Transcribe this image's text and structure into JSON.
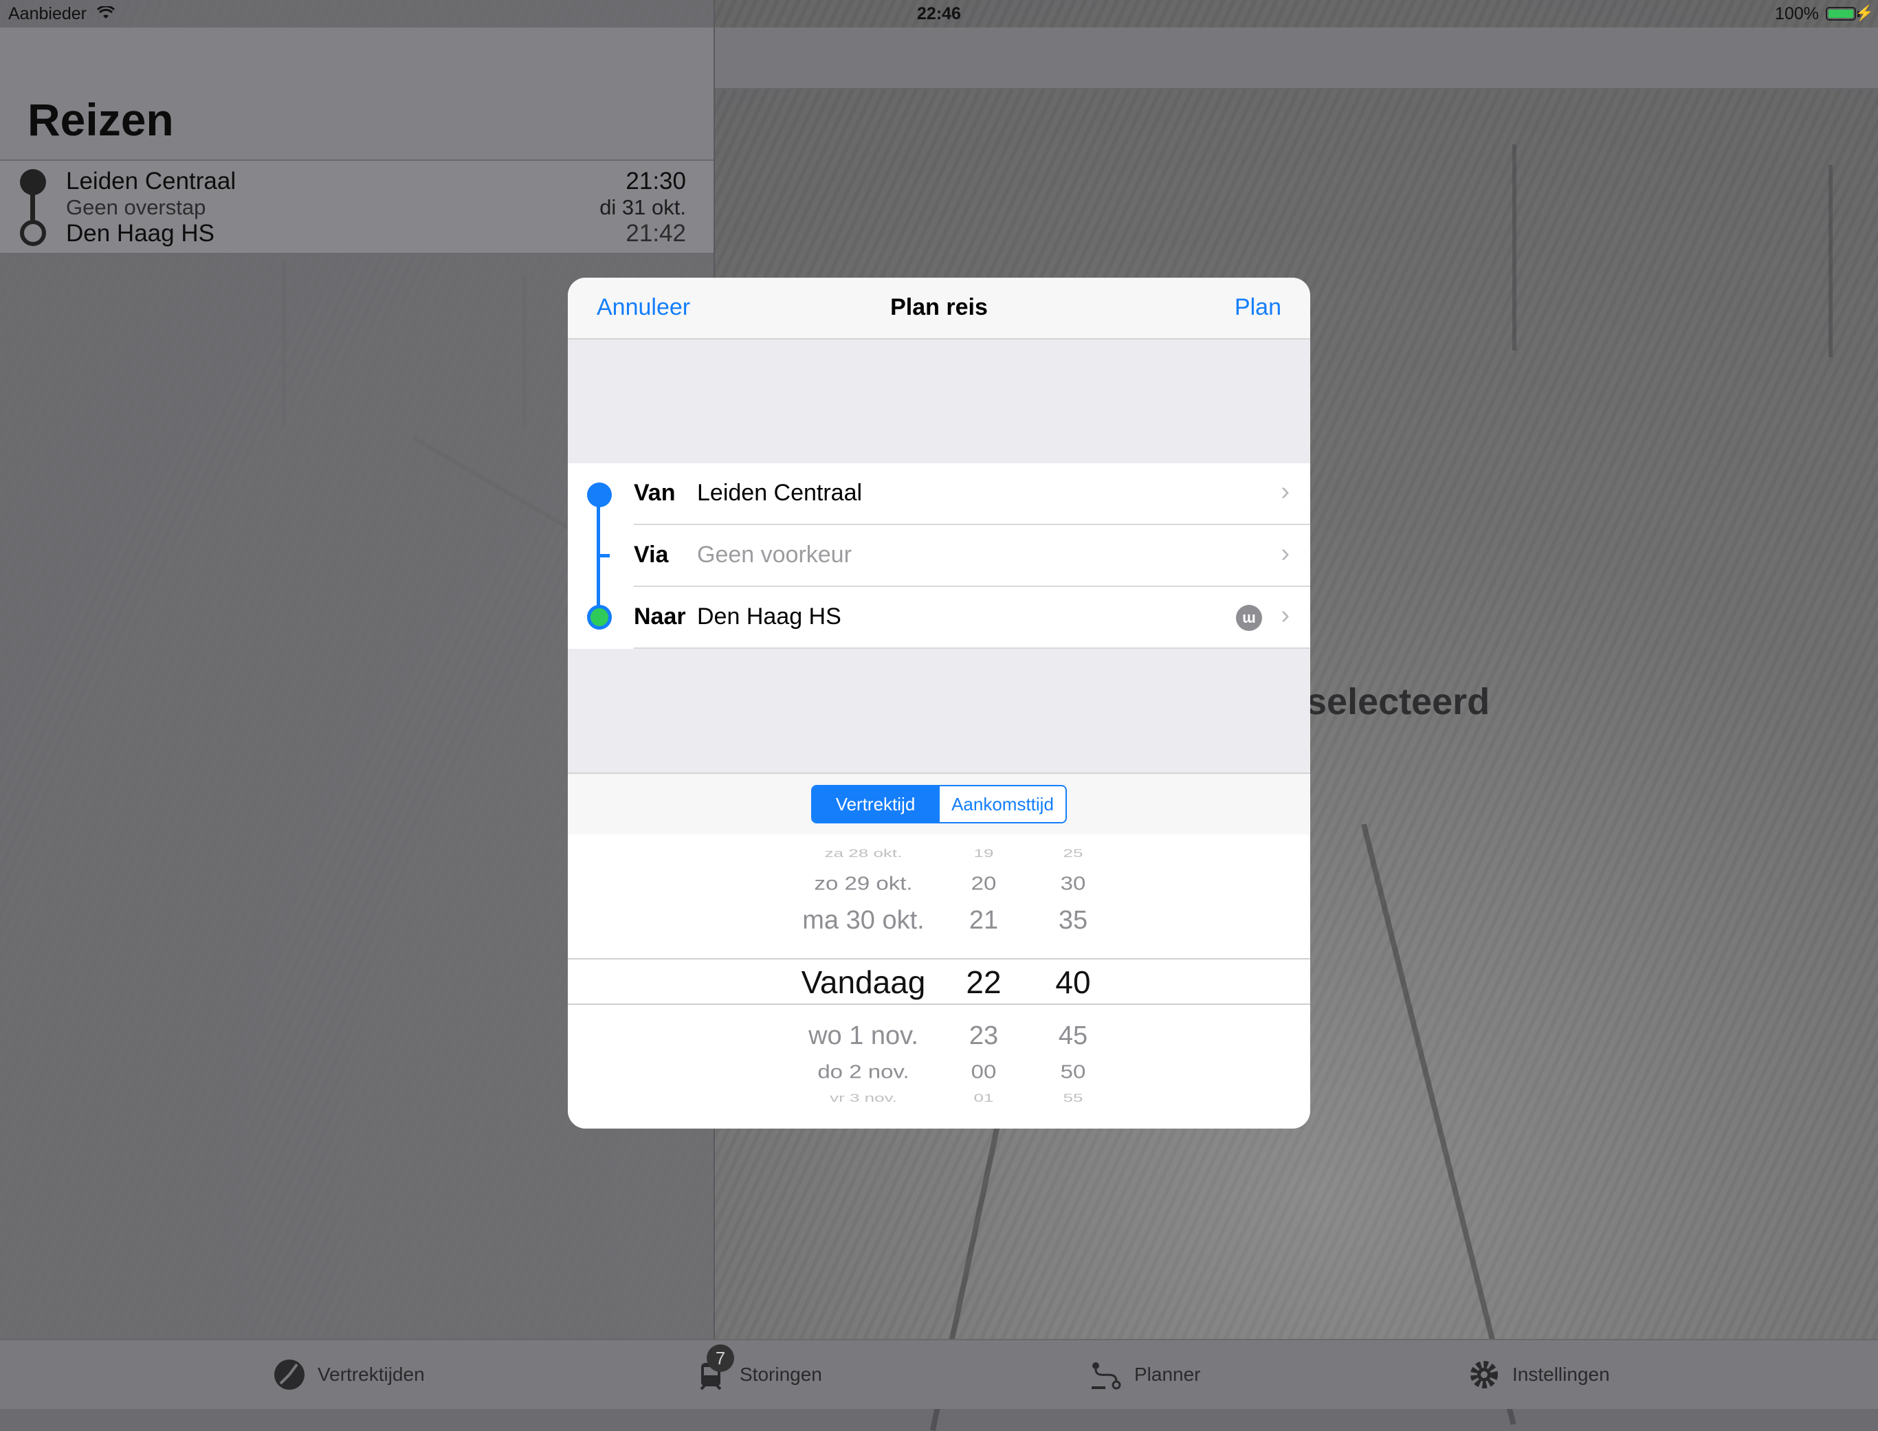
{
  "status_bar": {
    "carrier": "Aanbieder",
    "time": "22:46",
    "battery": "100%"
  },
  "master": {
    "title": "Reizen",
    "add_icon": "plus-icon",
    "trip": {
      "from": "Leiden Centraal",
      "via": "Geen overstap",
      "to": "Den Haag HS",
      "departure": "21:30",
      "date": "di 31 okt.",
      "arrival": "21:42"
    }
  },
  "detail": {
    "empty_text": "selecteerd"
  },
  "modal": {
    "cancel": "Annuleer",
    "title": "Plan reis",
    "plan": "Plan",
    "rows": [
      {
        "label": "Van",
        "value": "Leiden Centraal"
      },
      {
        "label": "Via",
        "value": "Geen voorkeur"
      },
      {
        "label": "Naar",
        "value": "Den Haag HS"
      }
    ],
    "segments": [
      "Vertrektijd",
      "Aankomsttijd"
    ],
    "selected_segment": "Vertrektijd",
    "picker": {
      "dates": [
        "za 28 okt.",
        "zo 29 okt.",
        "ma 30 okt.",
        "Vandaag",
        "wo 1 nov.",
        "do 2 nov.",
        "vr 3 nov."
      ],
      "hours": [
        "19",
        "20",
        "21",
        "22",
        "23",
        "00",
        "01"
      ],
      "minutes": [
        "25",
        "30",
        "35",
        "40",
        "45",
        "50",
        "55"
      ]
    }
  },
  "tabbar": [
    {
      "label": "Vertrektijden",
      "icon": "departures-icon"
    },
    {
      "label": "Storingen",
      "icon": "disruptions-icon",
      "badge": "7"
    },
    {
      "label": "Planner",
      "icon": "planner-icon"
    },
    {
      "label": "Instellingen",
      "icon": "settings-gear-icon"
    }
  ],
  "colors": {
    "accent": "#147efb",
    "destination": "#2fcb5a"
  }
}
